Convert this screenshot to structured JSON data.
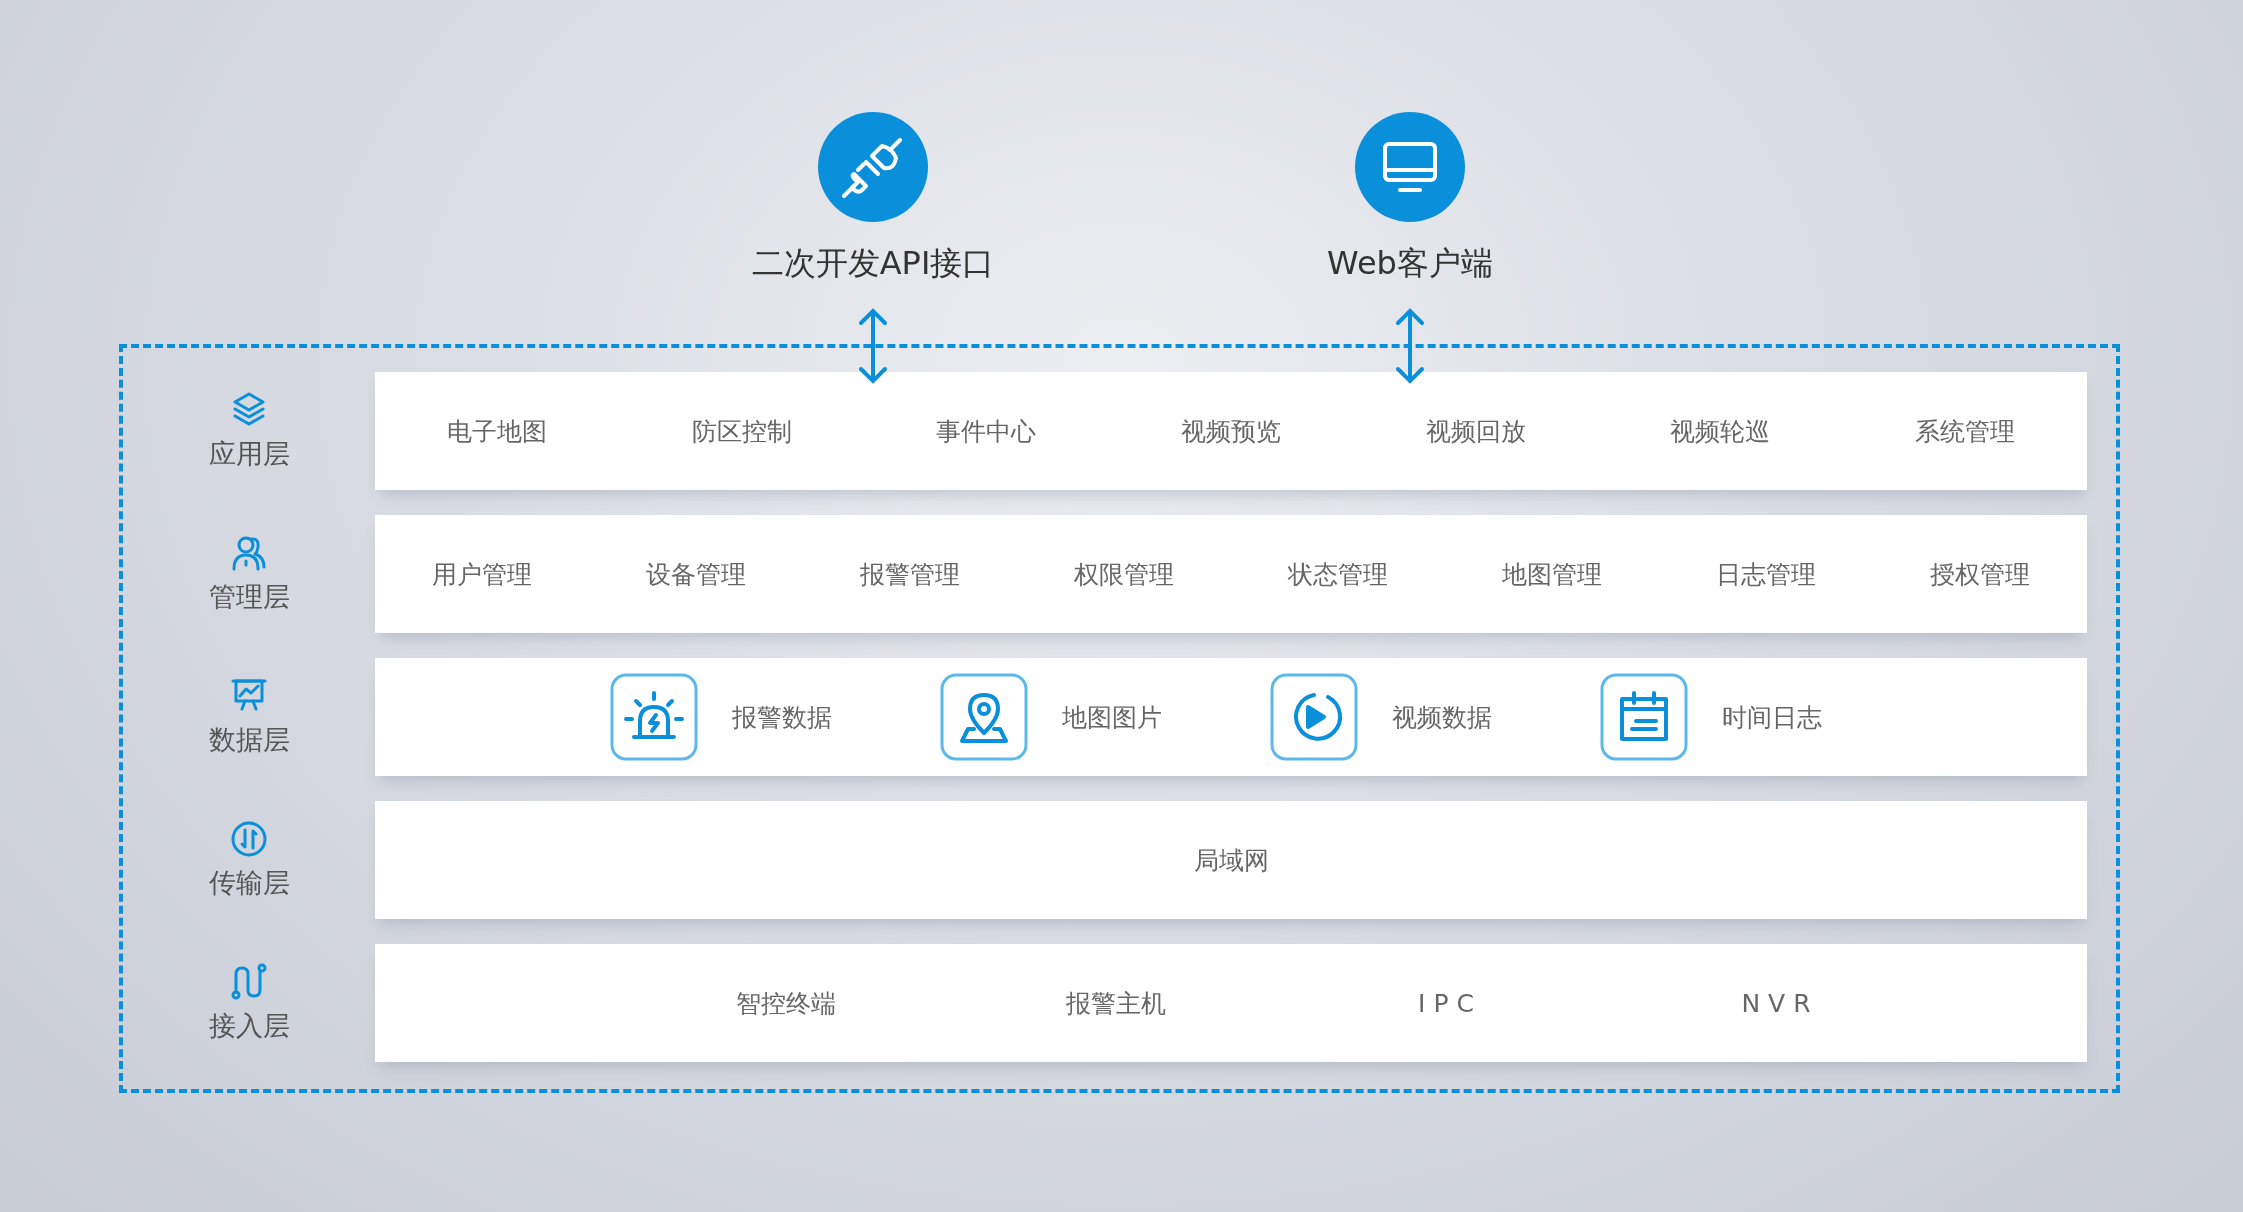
{
  "endpoints": [
    {
      "label": "二次开发API接口",
      "kind": "plug"
    },
    {
      "label": "Web客户端",
      "kind": "monitor"
    }
  ],
  "layers": [
    {
      "name": "应用层",
      "kind": "stack",
      "row": {
        "kind": "spread",
        "items": [
          {
            "label": "电子地图"
          },
          {
            "label": "防区控制"
          },
          {
            "label": "事件中心"
          },
          {
            "label": "视频预览"
          },
          {
            "label": "视频回放"
          },
          {
            "label": "视频轮巡"
          },
          {
            "label": "系统管理"
          }
        ]
      }
    },
    {
      "name": "管理层",
      "kind": "users",
      "row": {
        "kind": "spread",
        "items": [
          {
            "label": "用户管理"
          },
          {
            "label": "设备管理"
          },
          {
            "label": "报警管理"
          },
          {
            "label": "权限管理"
          },
          {
            "label": "状态管理"
          },
          {
            "label": "地图管理"
          },
          {
            "label": "日志管理"
          },
          {
            "label": "授权管理"
          }
        ]
      }
    },
    {
      "name": "数据层",
      "kind": "chart",
      "row": {
        "kind": "icons",
        "items": [
          {
            "label": "报警数据",
            "kind": "alarm"
          },
          {
            "label": "地图图片",
            "kind": "map"
          },
          {
            "label": "视频数据",
            "kind": "play"
          },
          {
            "label": "时间日志",
            "kind": "calendar"
          }
        ]
      }
    },
    {
      "name": "传输层",
      "kind": "transfer",
      "row": {
        "kind": "single",
        "items": [
          {
            "label": "局域网"
          }
        ]
      }
    },
    {
      "name": "接入层",
      "kind": "route",
      "row": {
        "kind": "columns",
        "items": [
          {
            "label": "智控终端"
          },
          {
            "label": "报警主机"
          },
          {
            "label": "I P C"
          },
          {
            "label": "N V R"
          }
        ]
      }
    }
  ]
}
